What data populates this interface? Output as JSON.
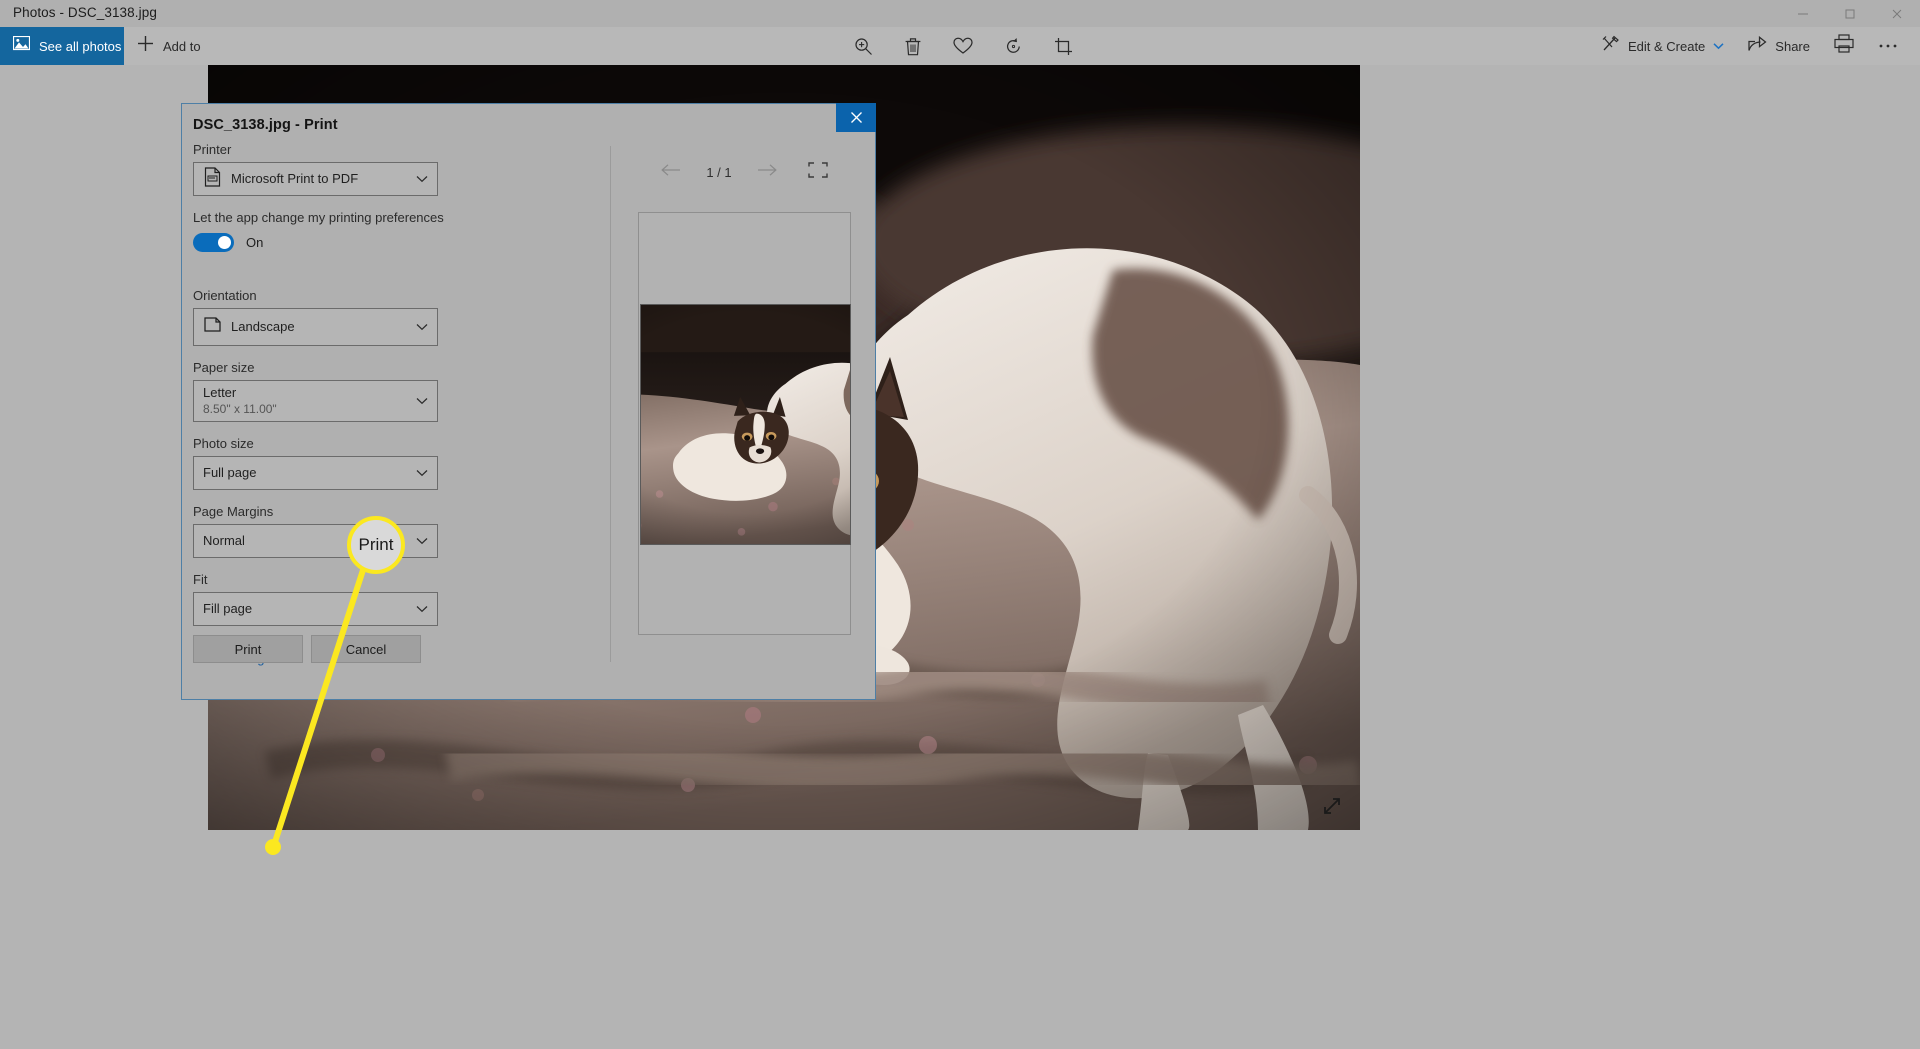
{
  "window": {
    "title": "Photos - DSC_3138.jpg",
    "controls": [
      {
        "name": "minimize",
        "glyph": "minimize-icon"
      },
      {
        "name": "maximize",
        "glyph": "maximize-icon"
      },
      {
        "name": "close",
        "glyph": "close-icon"
      }
    ]
  },
  "commandbar": {
    "see_all_photos": "See all photos",
    "see_all_icon": "photos-icon",
    "add_to": "Add to",
    "add_to_icon": "plus-icon",
    "center_tools": [
      {
        "name": "zoom-in-icon",
        "label": "Zoom"
      },
      {
        "name": "trash-icon",
        "label": "Delete"
      },
      {
        "name": "heart-icon",
        "label": "Add to favorites"
      },
      {
        "name": "rotate-icon",
        "label": "Rotate"
      },
      {
        "name": "crop-icon",
        "label": "Crop & rotate"
      }
    ],
    "edit_create": "Edit & Create",
    "edit_create_icon": "edit-create-icon",
    "edit_create_chevron": "chevron-down-icon",
    "share": "Share",
    "share_icon": "share-icon",
    "print_icon": "printer-icon",
    "more_icon": "more-ellipsis-icon"
  },
  "canvas": {
    "expand_icon": "expand-diagonal-icon"
  },
  "dialog": {
    "title": "DSC_3138.jpg - Print",
    "close_icon": "close-icon",
    "printer": {
      "label": "Printer",
      "value": "Microsoft Print to PDF",
      "icon": "printer-document-icon",
      "chevron": "chevron-down-icon"
    },
    "preferences": {
      "label": "Let the app change my printing preferences",
      "state": "On"
    },
    "orientation": {
      "label": "Orientation",
      "value": "Landscape",
      "icon": "page-landscape-icon",
      "chevron": "chevron-down-icon"
    },
    "paper_size": {
      "label": "Paper size",
      "value": "Letter",
      "sub": "8.50\" x 11.00\"",
      "chevron": "chevron-down-icon"
    },
    "photo_size": {
      "label": "Photo size",
      "value": "Full page",
      "chevron": "chevron-down-icon"
    },
    "page_margins": {
      "label": "Page Margins",
      "value": "Normal",
      "chevron": "chevron-down-icon"
    },
    "fit": {
      "label": "Fit",
      "value": "Fill page",
      "chevron": "chevron-down-icon"
    },
    "more_settings": "More settings",
    "buttons": {
      "print": "Print",
      "cancel": "Cancel"
    },
    "preview": {
      "prev_icon": "arrow-left-icon",
      "next_icon": "arrow-right-icon",
      "page_indicator": "1 / 1",
      "fit_icon": "fit-to-page-icon"
    }
  },
  "callout": {
    "label": "Print",
    "color": "#fbe820"
  },
  "colors": {
    "accent": "#14669e",
    "toggle_on": "#0a6cbb",
    "link": "#1d5e9e",
    "dialog_bg": "#b0b0b0",
    "app_bg": "#b4b4b4"
  }
}
